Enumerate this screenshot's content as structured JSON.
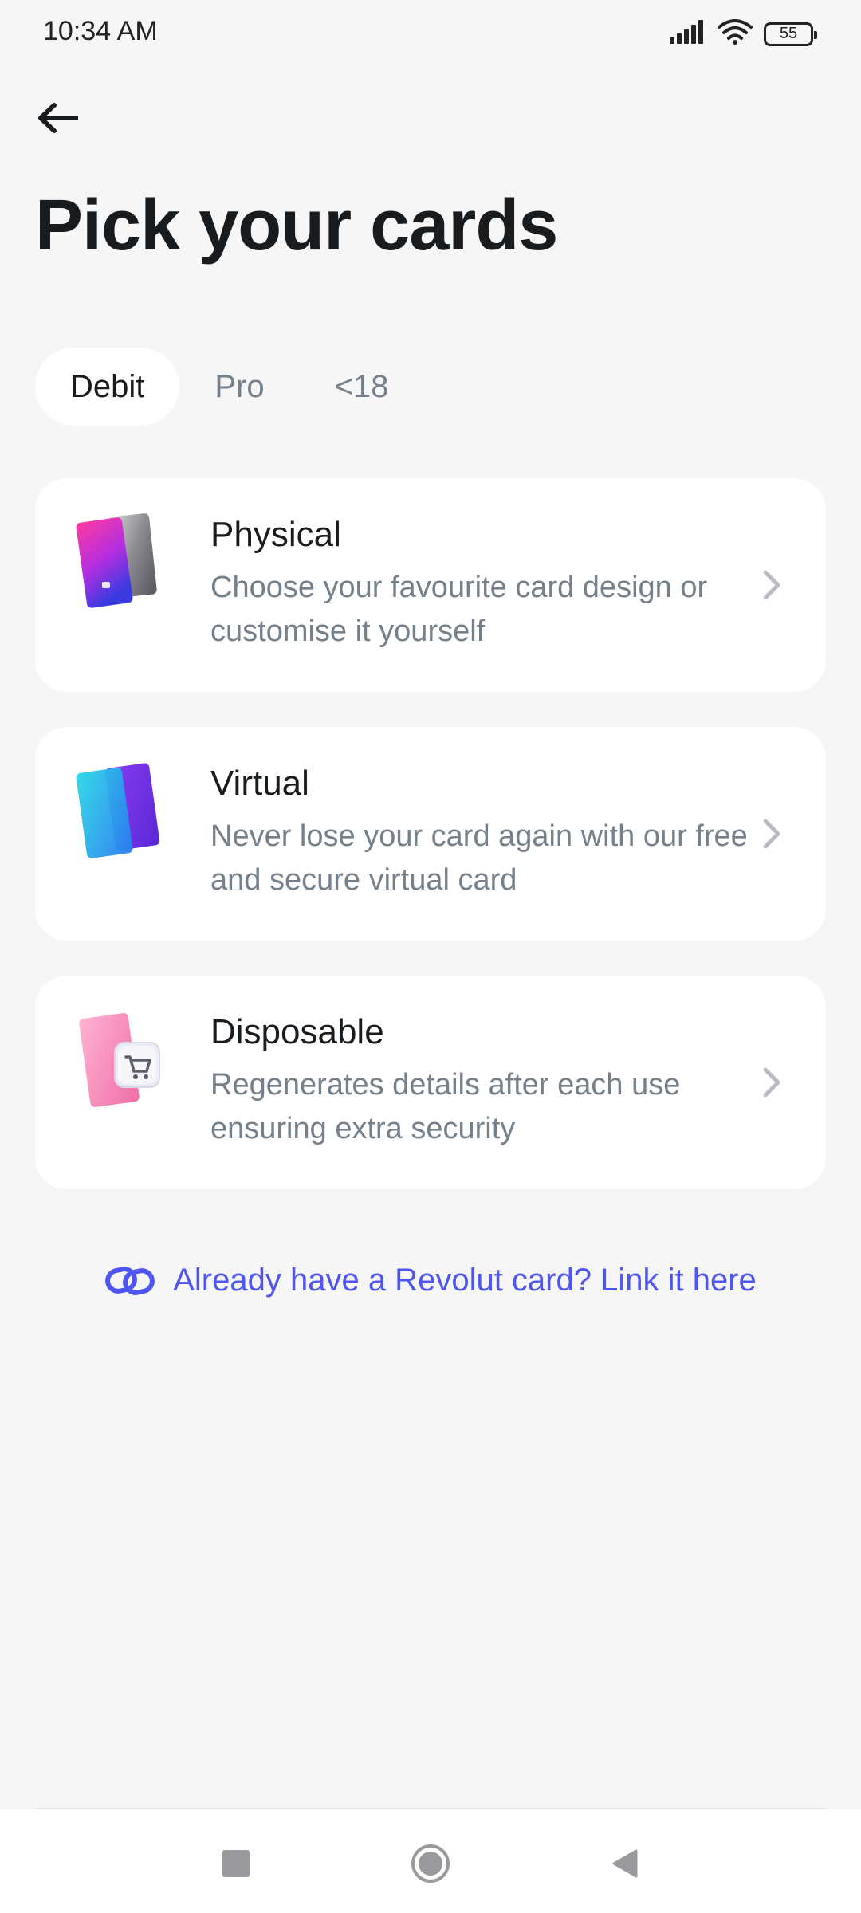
{
  "status_bar": {
    "time": "10:34 AM",
    "battery": "55",
    "icons": [
      "signal-icon",
      "wifi-icon",
      "battery-icon"
    ]
  },
  "header": {
    "back_icon": "back-arrow-icon",
    "title": "Pick your cards"
  },
  "tabs": [
    {
      "label": "Debit",
      "active": true
    },
    {
      "label": "Pro",
      "active": false
    },
    {
      "label": "<18",
      "active": false
    }
  ],
  "card_options": [
    {
      "title": "Physical",
      "description": "Choose your favourite card design or customise it yourself",
      "icon": "physical-cards-icon"
    },
    {
      "title": "Virtual",
      "description": "Never lose your card again with our free and secure virtual card",
      "icon": "virtual-cards-icon"
    },
    {
      "title": "Disposable",
      "description": "Regenerates details after each use ensuring extra security",
      "icon": "disposable-card-icon"
    }
  ],
  "link_card": {
    "label": "Already have a Revolut card? Link it here",
    "icon": "link-icon"
  },
  "nav_bar": {
    "buttons": [
      "recents-square-icon",
      "home-circle-icon",
      "back-triangle-icon"
    ]
  },
  "colors": {
    "background": "#f6f6f7",
    "card": "#ffffff",
    "accent": "#4f55f1",
    "secondary_text": "#75808a",
    "primary_text": "#191c1f"
  }
}
